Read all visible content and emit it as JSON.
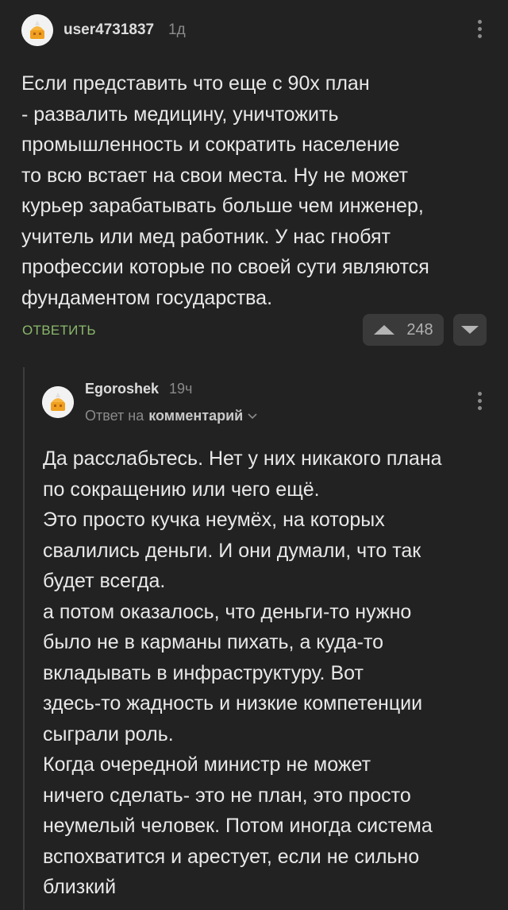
{
  "comment1": {
    "username": "user4731837",
    "time": "1д",
    "text": "Если представить что еще с 90х план\n- развалить медицину, уничтожить\nпромышленность и сократить население\nто всю встает на свои места. Ну не может\nкурьер зарабатывать больше чем инженер,\nучитель или мед работник. У нас гнобят\nпрофессии которые по своей сути являются\nфундаментом государства.",
    "reply_label": "ОТВЕТИТЬ",
    "rating": "248"
  },
  "comment2": {
    "username": "Egoroshek",
    "time": "19ч",
    "reply_prefix": "Ответ на",
    "reply_target": "комментарий",
    "text": "Да расслабьтесь. Нет у них никакого плана\nпо сокращению или чего ещё.\nЭто просто кучка неумёх, на которых\nсвалились деньги. И они думали, что так\nбудет всегда.\nа потом оказалось, что деньги-то нужно\nбыло не в карманы пихать, а куда-то\nвкладывать в инфраструктуру. Вот\nздесь-то жадность и низкие компетенции\nсыграли роль.\nКогда очередной министр не может\nничего сделать- это не план, это просто\nнеумелый человек. Потом иногда система\nвспохватится и арестует, если не сильно\nблизкий"
  },
  "colors": {
    "background": "#222222",
    "reply_accent": "#8ab86a",
    "avatar_accent": "#f0a020"
  },
  "icons": [
    "avatar-icon",
    "more-vertical-icon",
    "upvote-arrow-icon",
    "downvote-arrow-icon",
    "chevron-down-icon"
  ]
}
